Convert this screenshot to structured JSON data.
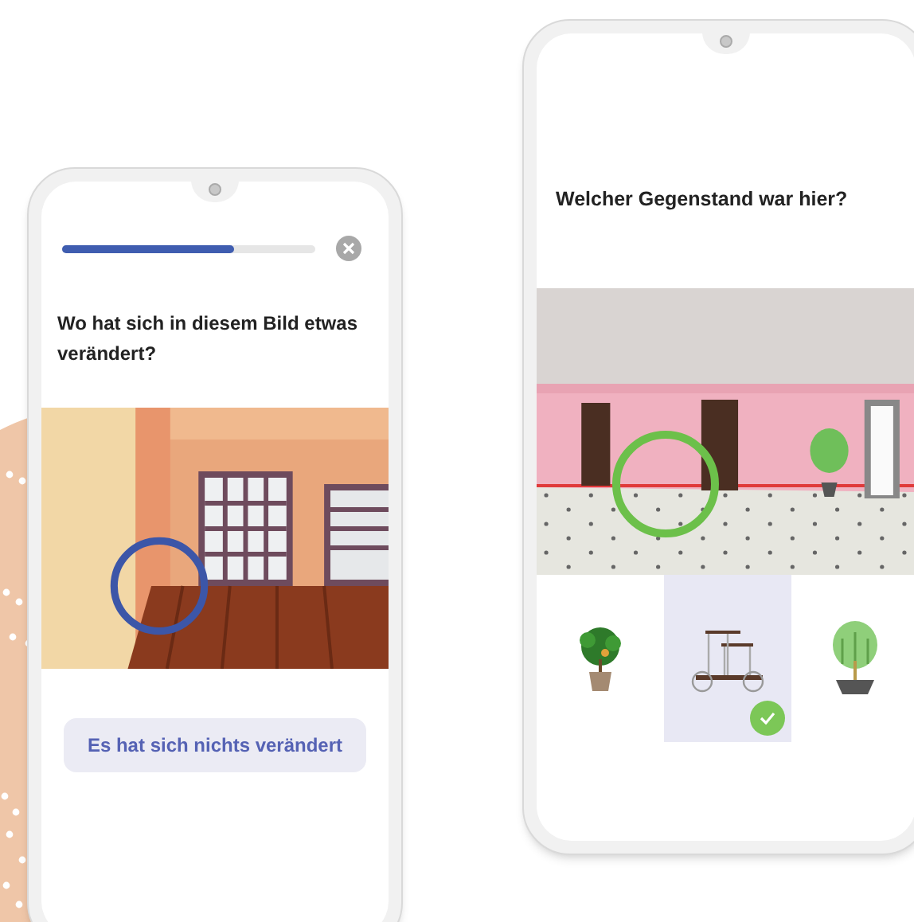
{
  "screens": [
    {
      "kind": "spot_difference",
      "progress": {
        "level": 0.68
      },
      "question": "Wo hat sich in diesem Bild etwas verändert?",
      "button": "Es hat sich nichts verändert"
    },
    {
      "kind": "which_object",
      "question": "Welcher Gegenstand war hier?",
      "options": [
        {
          "selected": false
        },
        {
          "selected": true
        },
        {
          "selected": false
        }
      ]
    }
  ]
}
